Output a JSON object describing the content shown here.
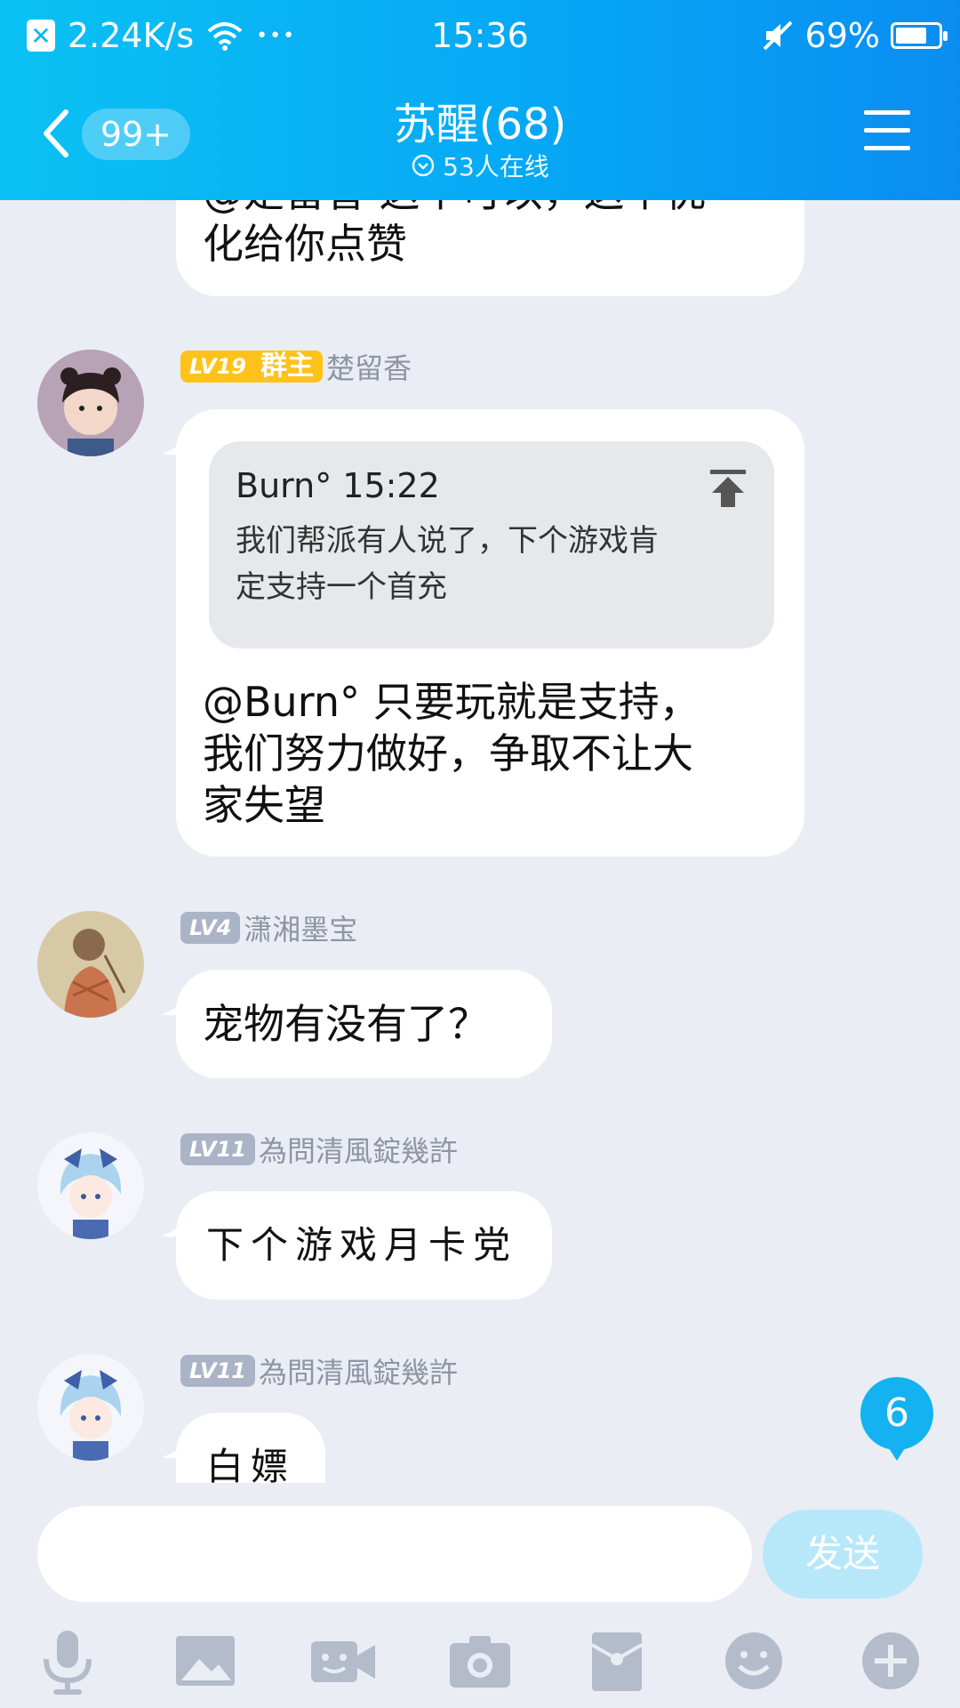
{
  "status": {
    "speed": "2.24K/s",
    "dots": "•••",
    "time": "15:36",
    "battery": "69%"
  },
  "header": {
    "back_badge": "99+",
    "title": "苏醒(68)",
    "online": "53人在线"
  },
  "messages": {
    "prev_partial_line1": "@是留香 这个可以，这个优",
    "prev_partial_line2": "化给你点赞",
    "m1": {
      "level": "LV19",
      "role": "群主",
      "name": "楚留香",
      "quote_head": "Burn° 15:22",
      "quote_line1": "我们帮派有人说了，下个游戏肯",
      "quote_line2": "定支持一个首充",
      "line1": "@Burn° 只要玩就是支持，",
      "line2": "我们努力做好，争取不让大",
      "line3": "家失望"
    },
    "m2": {
      "level": "LV4",
      "name": "潇湘墨宝",
      "text": "宠物有没有了？"
    },
    "m3": {
      "level": "LV11",
      "name": "為問清風錠幾許",
      "text": "下个游戏月卡党"
    },
    "m4": {
      "level": "LV11",
      "name": "為問清風錠幾許",
      "text": "白嫖"
    }
  },
  "unread_count": "6",
  "composer": {
    "input_value": "",
    "send_label": "发送"
  },
  "colors": {
    "header_start": "#0bc1f4",
    "header_end": "#0a8df2",
    "owner_badge": "#ffc21a",
    "level_badge": "#aab4c6",
    "send_button": "#b7e8fa"
  },
  "toolbar_icons": [
    "microphone-icon",
    "image-icon",
    "video-call-icon",
    "camera-icon",
    "red-packet-icon",
    "emoji-icon",
    "plus-icon"
  ]
}
